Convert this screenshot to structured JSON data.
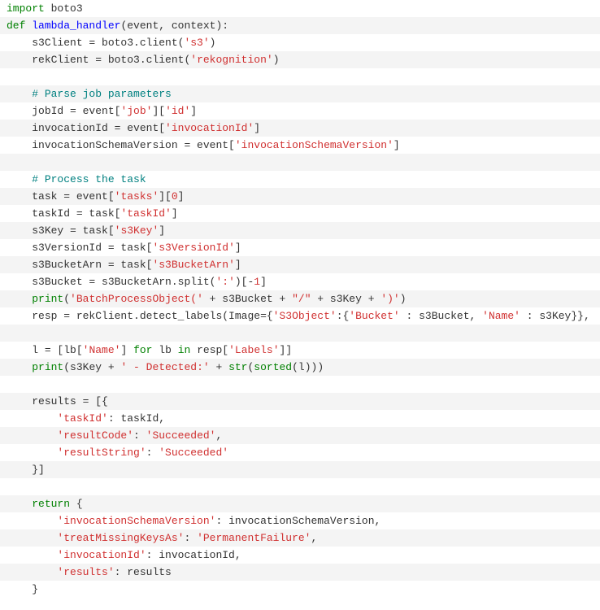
{
  "code": {
    "lines": [
      {
        "indent": 0,
        "tokens": [
          {
            "t": "import",
            "c": "green"
          },
          {
            "t": " boto3",
            "c": "id"
          }
        ]
      },
      {
        "indent": 0,
        "tokens": [
          {
            "t": "def",
            "c": "green"
          },
          {
            "t": " ",
            "c": "id"
          },
          {
            "t": "lambda_handler",
            "c": "blue"
          },
          {
            "t": "(event, context):",
            "c": "id"
          }
        ]
      },
      {
        "indent": 1,
        "tokens": [
          {
            "t": "s3Client = boto3.client(",
            "c": "id"
          },
          {
            "t": "'s3'",
            "c": "red-str"
          },
          {
            "t": ")",
            "c": "id"
          }
        ]
      },
      {
        "indent": 1,
        "tokens": [
          {
            "t": "rekClient = boto3.client(",
            "c": "id"
          },
          {
            "t": "'rekognition'",
            "c": "red-str"
          },
          {
            "t": ")",
            "c": "id"
          }
        ]
      },
      {
        "indent": 0,
        "tokens": []
      },
      {
        "indent": 1,
        "tokens": [
          {
            "t": "# Parse job parameters",
            "c": "teal"
          }
        ]
      },
      {
        "indent": 1,
        "tokens": [
          {
            "t": "jobId = event[",
            "c": "id"
          },
          {
            "t": "'job'",
            "c": "red-str"
          },
          {
            "t": "][",
            "c": "id"
          },
          {
            "t": "'id'",
            "c": "red-str"
          },
          {
            "t": "]",
            "c": "id"
          }
        ]
      },
      {
        "indent": 1,
        "tokens": [
          {
            "t": "invocationId = event[",
            "c": "id"
          },
          {
            "t": "'invocationId'",
            "c": "red-str"
          },
          {
            "t": "]",
            "c": "id"
          }
        ]
      },
      {
        "indent": 1,
        "tokens": [
          {
            "t": "invocationSchemaVersion = event[",
            "c": "id"
          },
          {
            "t": "'invocationSchemaVersion'",
            "c": "red-str"
          },
          {
            "t": "]",
            "c": "id"
          }
        ]
      },
      {
        "indent": 0,
        "tokens": []
      },
      {
        "indent": 1,
        "tokens": [
          {
            "t": "# Process the task",
            "c": "teal"
          }
        ]
      },
      {
        "indent": 1,
        "tokens": [
          {
            "t": "task = event[",
            "c": "id"
          },
          {
            "t": "'tasks'",
            "c": "red-str"
          },
          {
            "t": "][",
            "c": "id"
          },
          {
            "t": "0",
            "c": "red-str"
          },
          {
            "t": "]",
            "c": "id"
          }
        ]
      },
      {
        "indent": 1,
        "tokens": [
          {
            "t": "taskId = task[",
            "c": "id"
          },
          {
            "t": "'taskId'",
            "c": "red-str"
          },
          {
            "t": "]",
            "c": "id"
          }
        ]
      },
      {
        "indent": 1,
        "tokens": [
          {
            "t": "s3Key = task[",
            "c": "id"
          },
          {
            "t": "'s3Key'",
            "c": "red-str"
          },
          {
            "t": "]",
            "c": "id"
          }
        ]
      },
      {
        "indent": 1,
        "tokens": [
          {
            "t": "s3VersionId = task[",
            "c": "id"
          },
          {
            "t": "'s3VersionId'",
            "c": "red-str"
          },
          {
            "t": "]",
            "c": "id"
          }
        ]
      },
      {
        "indent": 1,
        "tokens": [
          {
            "t": "s3BucketArn = task[",
            "c": "id"
          },
          {
            "t": "'s3BucketArn'",
            "c": "red-str"
          },
          {
            "t": "]",
            "c": "id"
          }
        ]
      },
      {
        "indent": 1,
        "tokens": [
          {
            "t": "s3Bucket = s3BucketArn.split(",
            "c": "id"
          },
          {
            "t": "':'",
            "c": "red-str"
          },
          {
            "t": ")[-",
            "c": "id"
          },
          {
            "t": "1",
            "c": "red-str"
          },
          {
            "t": "]",
            "c": "id"
          }
        ]
      },
      {
        "indent": 1,
        "tokens": [
          {
            "t": "print",
            "c": "green"
          },
          {
            "t": "(",
            "c": "id"
          },
          {
            "t": "'BatchProcessObject('",
            "c": "red-str"
          },
          {
            "t": " + s3Bucket + ",
            "c": "id"
          },
          {
            "t": "\"/\"",
            "c": "red-str"
          },
          {
            "t": " + s3Key + ",
            "c": "id"
          },
          {
            "t": "')'",
            "c": "red-str"
          },
          {
            "t": ")",
            "c": "id"
          }
        ]
      },
      {
        "indent": 1,
        "tokens": [
          {
            "t": "resp = rekClient.detect_labels(Image={",
            "c": "id"
          },
          {
            "t": "'S3Object'",
            "c": "red-str"
          },
          {
            "t": ":{",
            "c": "id"
          },
          {
            "t": "'Bucket'",
            "c": "red-str"
          },
          {
            "t": " : s3Bucket, ",
            "c": "id"
          },
          {
            "t": "'Name'",
            "c": "red-str"
          },
          {
            "t": " : s3Key}},",
            "c": "id"
          }
        ]
      },
      {
        "indent": 0,
        "tokens": []
      },
      {
        "indent": 1,
        "tokens": [
          {
            "t": "l = [lb[",
            "c": "id"
          },
          {
            "t": "'Name'",
            "c": "red-str"
          },
          {
            "t": "] ",
            "c": "id"
          },
          {
            "t": "for",
            "c": "green"
          },
          {
            "t": " lb ",
            "c": "id"
          },
          {
            "t": "in",
            "c": "green"
          },
          {
            "t": " resp[",
            "c": "id"
          },
          {
            "t": "'Labels'",
            "c": "red-str"
          },
          {
            "t": "]]",
            "c": "id"
          }
        ]
      },
      {
        "indent": 1,
        "tokens": [
          {
            "t": "print",
            "c": "green"
          },
          {
            "t": "(s3Key + ",
            "c": "id"
          },
          {
            "t": "' - Detected:'",
            "c": "red-str"
          },
          {
            "t": " + ",
            "c": "id"
          },
          {
            "t": "str",
            "c": "green"
          },
          {
            "t": "(",
            "c": "id"
          },
          {
            "t": "sorted",
            "c": "green"
          },
          {
            "t": "(l)))",
            "c": "id"
          }
        ]
      },
      {
        "indent": 0,
        "tokens": []
      },
      {
        "indent": 1,
        "tokens": [
          {
            "t": "results = [{",
            "c": "id"
          }
        ]
      },
      {
        "indent": 2,
        "tokens": [
          {
            "t": "'taskId'",
            "c": "red-str"
          },
          {
            "t": ": taskId,",
            "c": "id"
          }
        ]
      },
      {
        "indent": 2,
        "tokens": [
          {
            "t": "'resultCode'",
            "c": "red-str"
          },
          {
            "t": ": ",
            "c": "id"
          },
          {
            "t": "'Succeeded'",
            "c": "red-str"
          },
          {
            "t": ",",
            "c": "id"
          }
        ]
      },
      {
        "indent": 2,
        "tokens": [
          {
            "t": "'resultString'",
            "c": "red-str"
          },
          {
            "t": ": ",
            "c": "id"
          },
          {
            "t": "'Succeeded'",
            "c": "red-str"
          }
        ]
      },
      {
        "indent": 1,
        "tokens": [
          {
            "t": "}]",
            "c": "id"
          }
        ]
      },
      {
        "indent": 0,
        "tokens": []
      },
      {
        "indent": 1,
        "tokens": [
          {
            "t": "return",
            "c": "green"
          },
          {
            "t": " {",
            "c": "id"
          }
        ]
      },
      {
        "indent": 2,
        "tokens": [
          {
            "t": "'invocationSchemaVersion'",
            "c": "red-str"
          },
          {
            "t": ": invocationSchemaVersion,",
            "c": "id"
          }
        ]
      },
      {
        "indent": 2,
        "tokens": [
          {
            "t": "'treatMissingKeysAs'",
            "c": "red-str"
          },
          {
            "t": ": ",
            "c": "id"
          },
          {
            "t": "'PermanentFailure'",
            "c": "red-str"
          },
          {
            "t": ",",
            "c": "id"
          }
        ]
      },
      {
        "indent": 2,
        "tokens": [
          {
            "t": "'invocationId'",
            "c": "red-str"
          },
          {
            "t": ": invocationId,",
            "c": "id"
          }
        ]
      },
      {
        "indent": 2,
        "tokens": [
          {
            "t": "'results'",
            "c": "red-str"
          },
          {
            "t": ": results",
            "c": "id"
          }
        ]
      },
      {
        "indent": 1,
        "tokens": [
          {
            "t": "}",
            "c": "id"
          }
        ]
      }
    ]
  },
  "colors": {
    "green": "#008000",
    "blue": "#0000ff",
    "red-str": "#d03030",
    "teal": "#008080",
    "id": "#333333"
  }
}
